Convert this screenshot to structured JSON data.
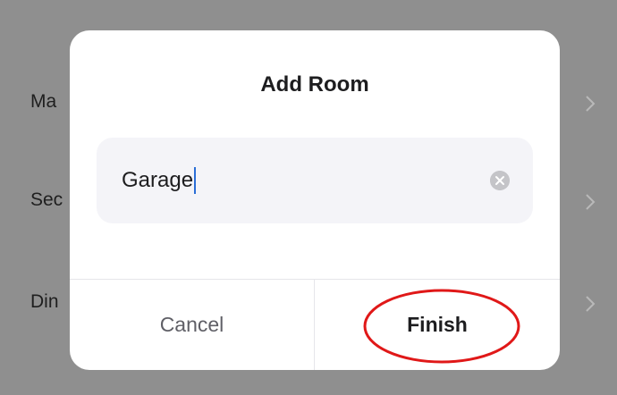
{
  "background": {
    "rows": [
      {
        "label": "Ma"
      },
      {
        "label": "Sec"
      },
      {
        "label": "Din"
      }
    ]
  },
  "dialog": {
    "title": "Add Room",
    "input": {
      "value": "Garage"
    },
    "buttons": {
      "cancel": "Cancel",
      "finish": "Finish"
    }
  },
  "colors": {
    "caret": "#2a6ed6",
    "annotation": "#e01818"
  },
  "icons": {
    "row_chevron": "chevron-right-icon",
    "input_clear": "clear-icon"
  }
}
